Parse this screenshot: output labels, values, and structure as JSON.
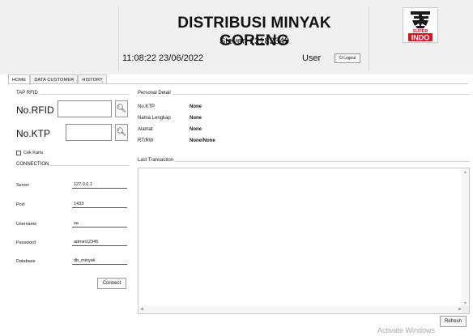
{
  "header": {
    "title": "DISTRIBUSI MINYAK GORENG",
    "subtitle": "Steven 12182349",
    "datetime": "11:08:22 23/06/2022",
    "user_label": "User",
    "logout_label": "Logout",
    "logo_text_top": "SUPER",
    "logo_text_bottom": "INDO"
  },
  "tabs": [
    {
      "label": "HOME",
      "active": true
    },
    {
      "label": "DATA CUSTOMER",
      "active": false
    },
    {
      "label": "HISTORY",
      "active": false
    }
  ],
  "tap_rfid": {
    "group_title": "TAP RFID",
    "rfid_label": "No.RFID",
    "rfid_value": "",
    "ktp_label": "No.KTP",
    "ktp_value": "",
    "checkbox_label": "Cek Kartu",
    "checkbox_checked": false
  },
  "connection": {
    "group_title": "CONNECTION",
    "fields": [
      {
        "label": "Server",
        "value": "127.0.0.1"
      },
      {
        "label": "Port",
        "value": "1433"
      },
      {
        "label": "Username",
        "value": "sa"
      },
      {
        "label": "Password",
        "value": "admin12345"
      },
      {
        "label": "Database",
        "value": "db_minyak"
      }
    ],
    "connect_label": "Connect"
  },
  "personal_detail": {
    "group_title": "Personal Detail",
    "rows": [
      {
        "key": "No.KTP",
        "value": "None"
      },
      {
        "key": "Nama Lengkap",
        "value": "None"
      },
      {
        "key": "Alamat",
        "value": "None"
      },
      {
        "key": "RT/RW",
        "value": "None/None"
      }
    ]
  },
  "last_transaction": {
    "group_title": "Last Transaction",
    "refresh_label": "Refresh"
  },
  "watermark": "Activate Windows",
  "colors": {
    "header_bg": "#f0f0f0",
    "logo_red": "#d7141c",
    "logo_dark": "#1a1a1a"
  }
}
